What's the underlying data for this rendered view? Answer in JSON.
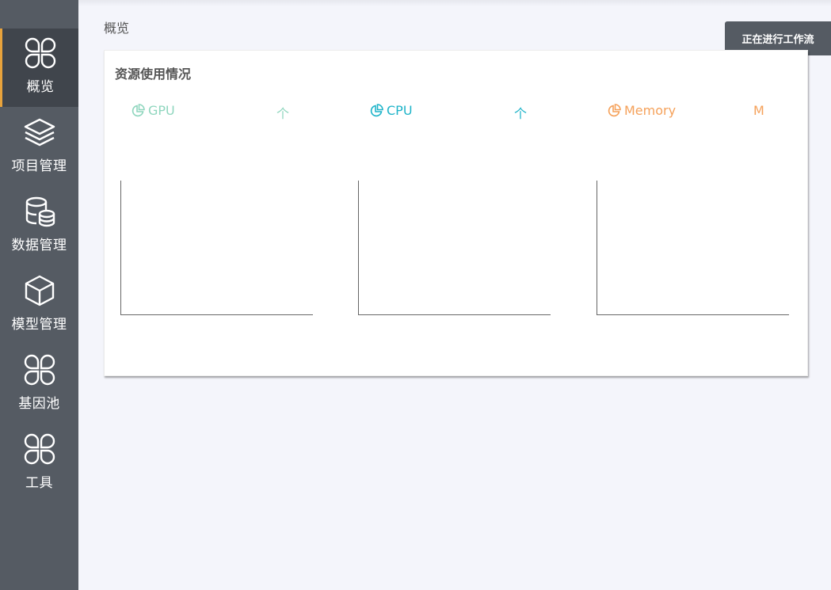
{
  "sidebar": {
    "items": [
      {
        "label": "概览",
        "icon": "clover-icon",
        "active": true
      },
      {
        "label": "项目管理",
        "icon": "layers-icon",
        "active": false
      },
      {
        "label": "数据管理",
        "icon": "database-icon",
        "active": false
      },
      {
        "label": "模型管理",
        "icon": "cube-icon",
        "active": false
      },
      {
        "label": "基因池",
        "icon": "clover-icon",
        "active": false
      },
      {
        "label": "工具",
        "icon": "clover-icon",
        "active": false
      }
    ]
  },
  "header": {
    "breadcrumb": "概览",
    "workflow_button": "正在进行工作流"
  },
  "card": {
    "title": "资源使用情况",
    "metrics": [
      {
        "name": "GPU",
        "trend": "个",
        "color": "#8fd6be",
        "icon": "pie-chart-icon"
      },
      {
        "name": "CPU",
        "trend": "个",
        "color": "#1fb4c9",
        "icon": "pie-chart-icon"
      },
      {
        "name": "Memory",
        "trend": "M",
        "color": "#f5a15a",
        "icon": "pie-chart-icon"
      }
    ]
  },
  "colors": {
    "sidebar_bg": "#555b63",
    "sidebar_active_bg": "#40454c",
    "accent": "#e8a33c",
    "page_bg": "#f4f5fb"
  }
}
